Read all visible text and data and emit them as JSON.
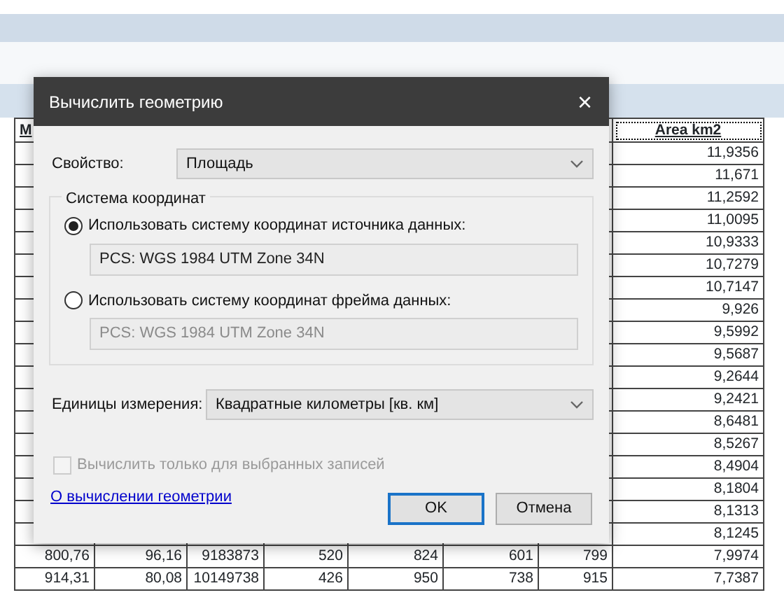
{
  "table": {
    "columns": [
      "M",
      "Area km2"
    ],
    "rows": [
      {
        "area": "11,9356"
      },
      {
        "area": "11,671"
      },
      {
        "area": "11,2592"
      },
      {
        "area": "11,0095"
      },
      {
        "area": "10,9333"
      },
      {
        "area": "10,7279"
      },
      {
        "area": "10,7147"
      },
      {
        "area": "9,926"
      },
      {
        "area": "9,5992"
      },
      {
        "area": "9,5687"
      },
      {
        "area": "9,2644"
      },
      {
        "area": "9,2421"
      },
      {
        "area": "8,6481"
      },
      {
        "area": "8,5267"
      },
      {
        "area": "8,4904"
      },
      {
        "area": "8,1804"
      },
      {
        "area": "8,1313"
      },
      {
        "area": "8,1245"
      },
      {
        "cells": [
          "800,76",
          "96,16",
          "9183873",
          "520",
          "824",
          "601",
          "799"
        ],
        "area": "7,9974"
      },
      {
        "cells": [
          "914,31",
          "80,08",
          "10149738",
          "426",
          "950",
          "738",
          "915"
        ],
        "area": "7,7387"
      }
    ]
  },
  "dialog": {
    "title": "Вычислить геометрию",
    "close": "×",
    "property": {
      "label": "Свойство:",
      "value": "Площадь"
    },
    "coordinate_system": {
      "legend": "Система координат",
      "options": [
        {
          "label": "Использовать систему координат источника данных:",
          "selected": true,
          "value": "PCS: WGS 1984 UTM Zone 34N"
        },
        {
          "label": "Использовать систему координат фрейма данных:",
          "selected": false,
          "value": "PCS: WGS 1984 UTM Zone 34N"
        }
      ]
    },
    "units": {
      "label": "Единицы измерения:",
      "value": "Квадратные километры [кв. км]"
    },
    "selected_only": {
      "label": "Вычислить только для выбранных записей",
      "checked": false,
      "disabled": true
    },
    "help_link": "О вычислении геометрии",
    "buttons": [
      {
        "label": "OK",
        "default": true
      },
      {
        "label": "Отмена",
        "default": false
      }
    ]
  }
}
